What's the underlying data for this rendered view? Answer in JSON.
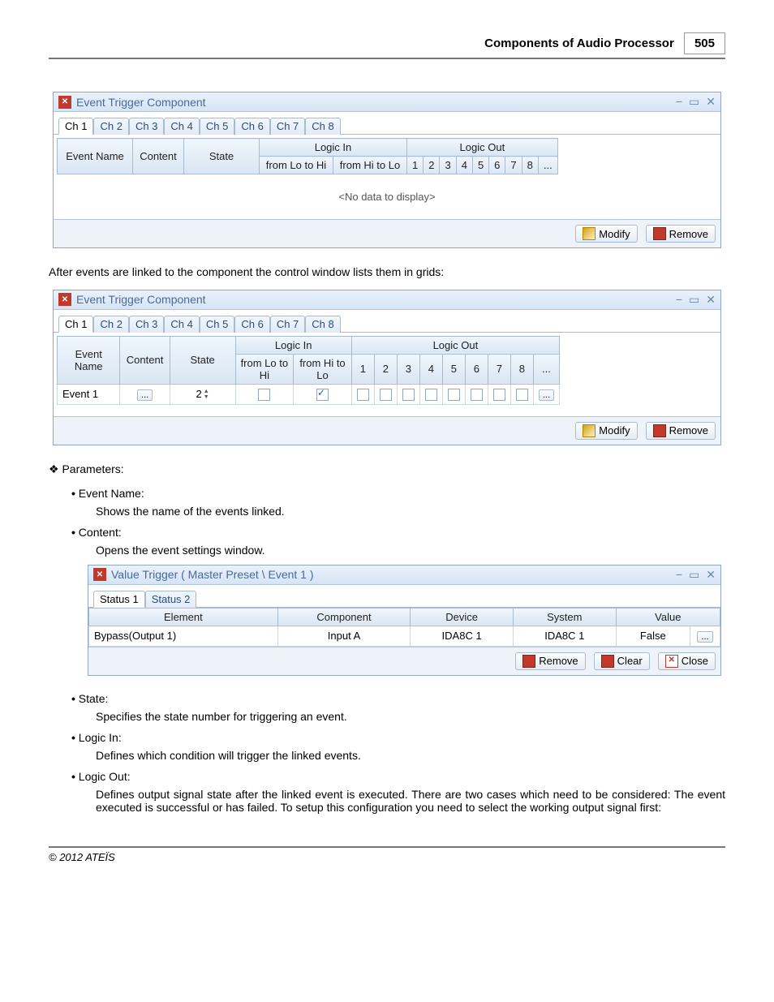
{
  "header": {
    "title": "Components of Audio Processor",
    "page_number": "505"
  },
  "tabs": [
    "Ch 1",
    "Ch 2",
    "Ch 3",
    "Ch 4",
    "Ch 5",
    "Ch 6",
    "Ch 7",
    "Ch 8"
  ],
  "grid_columns": {
    "event_name": "Event Name",
    "content": "Content",
    "state": "State",
    "logic_in": "Logic In",
    "logic_in_lo_hi": "from Lo to Hi",
    "logic_in_hi_lo": "from Hi to Lo",
    "logic_out": "Logic Out",
    "logic_out_cols": [
      "1",
      "2",
      "3",
      "4",
      "5",
      "6",
      "7",
      "8",
      "..."
    ]
  },
  "no_data_text": "<No data to display>",
  "buttons": {
    "modify": "Modify",
    "remove": "Remove",
    "clear": "Clear",
    "close": "Close"
  },
  "window_title": "Event Trigger Component",
  "para_after": "After events are linked to the component the control window lists them in grids:",
  "event_row": {
    "name": "Event 1",
    "content": "...",
    "state": "2",
    "lo_hi_checked": false,
    "hi_lo_checked": true
  },
  "params_label": "Parameters:",
  "params": {
    "event_name": {
      "title": "Event Name:",
      "desc": "Shows the name of the events linked."
    },
    "content": {
      "title": "Content:",
      "desc": "Opens the event settings window."
    },
    "state": {
      "title": "State:",
      "desc": "Specifies the state number for triggering an event."
    },
    "logic_in": {
      "title": "Logic In:",
      "desc": "Defines which condition will trigger the linked events."
    },
    "logic_out": {
      "title": "Logic Out:",
      "desc": "Defines output signal state after the linked event is executed. There are two cases which need to be considered: The event executed is successful or has failed. To setup this configuration you need to select the working output signal first:"
    }
  },
  "value_trigger": {
    "title": "Value Trigger ( Master Preset \\ Event 1 )",
    "tabs": [
      "Status 1",
      "Status 2"
    ],
    "columns": [
      "Element",
      "Component",
      "Device",
      "System",
      "Value"
    ],
    "row": {
      "element": "Bypass(Output 1)",
      "component": "Input A",
      "device": "IDA8C 1",
      "system": "IDA8C 1",
      "value": "False",
      "more": "..."
    }
  },
  "footer": "© 2012 ATEÏS"
}
